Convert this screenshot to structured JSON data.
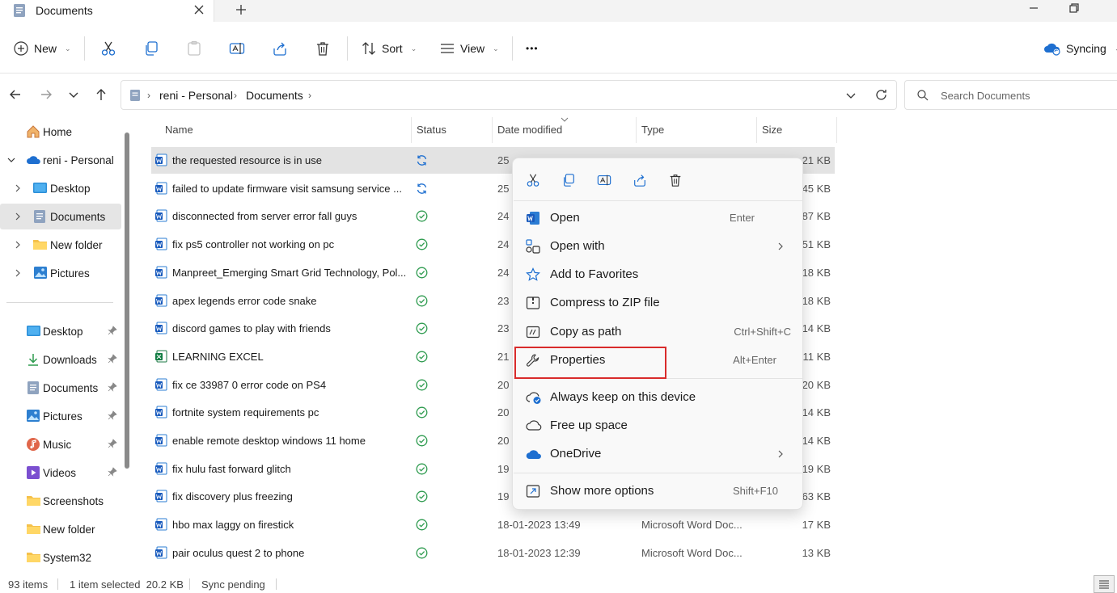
{
  "window": {
    "tab_title": "Documents",
    "sync_status": "Syncing"
  },
  "toolbar": {
    "new_label": "New",
    "sort_label": "Sort",
    "view_label": "View",
    "more_label": "•••"
  },
  "address": {
    "crumbs": [
      "reni - Personal",
      "Documents"
    ],
    "search_placeholder": "Search Documents"
  },
  "sidebar": {
    "tree": [
      {
        "label": "Home",
        "icon": "home-icon"
      },
      {
        "label": "reni - Personal",
        "icon": "onedrive-cloud-icon"
      },
      {
        "label": "Desktop",
        "icon": "desktop-folder-icon"
      },
      {
        "label": "Documents",
        "icon": "documents-folder-icon",
        "selected": true
      },
      {
        "label": "New folder",
        "icon": "folder-icon"
      },
      {
        "label": "Pictures",
        "icon": "pictures-folder-icon"
      }
    ],
    "quick_access": [
      {
        "label": "Desktop",
        "pinned": true
      },
      {
        "label": "Downloads",
        "pinned": true
      },
      {
        "label": "Documents",
        "pinned": true
      },
      {
        "label": "Pictures",
        "pinned": true
      },
      {
        "label": "Music",
        "pinned": true
      },
      {
        "label": "Videos",
        "pinned": true
      },
      {
        "label": "Screenshots",
        "pinned": false
      },
      {
        "label": "New folder",
        "pinned": false
      },
      {
        "label": "System32",
        "pinned": false
      }
    ]
  },
  "columns": {
    "name": "Name",
    "status": "Status",
    "date": "Date modified",
    "type": "Type",
    "size": "Size"
  },
  "files": [
    {
      "name": "the requested resource is in use",
      "status": "syncing",
      "date": "25",
      "type": "",
      "size": "21 KB",
      "icon": "word",
      "selected": true
    },
    {
      "name": "failed to update firmware visit samsung service ...",
      "status": "syncing",
      "date": "25",
      "type": "",
      "size": "45 KB",
      "icon": "word"
    },
    {
      "name": "disconnected from server error fall guys",
      "status": "synced",
      "date": "24",
      "type": "",
      "size": "87 KB",
      "icon": "word"
    },
    {
      "name": "fix ps5 controller not working on pc",
      "status": "synced",
      "date": "24",
      "type": "",
      "size": "51 KB",
      "icon": "word"
    },
    {
      "name": "Manpreet_Emerging Smart Grid Technology, Pol...",
      "status": "synced",
      "date": "24",
      "type": "",
      "size": "18 KB",
      "icon": "word"
    },
    {
      "name": "apex legends error code snake",
      "status": "synced",
      "date": "23",
      "type": "",
      "size": "18 KB",
      "icon": "word"
    },
    {
      "name": "discord games to play with friends",
      "status": "synced",
      "date": "23",
      "type": "",
      "size": "14 KB",
      "icon": "word"
    },
    {
      "name": "LEARNING EXCEL",
      "status": "synced",
      "date": "21",
      "type": "",
      "size": "11 KB",
      "icon": "excel"
    },
    {
      "name": "fix ce 33987 0 error code on PS4",
      "status": "synced",
      "date": "20",
      "type": "",
      "size": "20 KB",
      "icon": "word"
    },
    {
      "name": "fortnite system requirements pc",
      "status": "synced",
      "date": "20",
      "type": "",
      "size": "14 KB",
      "icon": "word"
    },
    {
      "name": "enable remote desktop windows 11 home",
      "status": "synced",
      "date": "20",
      "type": "",
      "size": "14 KB",
      "icon": "word"
    },
    {
      "name": "fix hulu fast forward glitch",
      "status": "synced",
      "date": "19",
      "type": "",
      "size": "19 KB",
      "icon": "word"
    },
    {
      "name": "fix discovery plus freezing",
      "status": "synced",
      "date": "19",
      "type": "",
      "size": "63 KB",
      "icon": "word"
    },
    {
      "name": "hbo max laggy on firestick",
      "status": "synced",
      "date": "18-01-2023 13:49",
      "type": "Microsoft Word Doc...",
      "size": "17 KB",
      "icon": "word"
    },
    {
      "name": "pair oculus quest 2 to phone",
      "status": "synced",
      "date": "18-01-2023 12:39",
      "type": "Microsoft Word Doc...",
      "size": "13 KB",
      "icon": "word"
    }
  ],
  "context_menu": {
    "items": [
      {
        "label": "Open",
        "shortcut": "Enter",
        "icon": "word-app-icon"
      },
      {
        "label": "Open with",
        "shortcut": "",
        "icon": "open-with-icon",
        "submenu": true
      },
      {
        "label": "Add to Favorites",
        "shortcut": "",
        "icon": "star-icon"
      },
      {
        "label": "Compress to ZIP file",
        "shortcut": "",
        "icon": "zip-icon"
      },
      {
        "label": "Copy as path",
        "shortcut": "Ctrl+Shift+C",
        "icon": "copy-path-icon"
      },
      {
        "label": "Properties",
        "shortcut": "Alt+Enter",
        "icon": "wrench-icon",
        "highlighted": true
      },
      {
        "label": "Always keep on this device",
        "shortcut": "",
        "icon": "cloud-sync-icon"
      },
      {
        "label": "Free up space",
        "shortcut": "",
        "icon": "cloud-outline-icon"
      },
      {
        "label": "OneDrive",
        "shortcut": "",
        "icon": "onedrive-icon",
        "submenu": true
      },
      {
        "label": "Show more options",
        "shortcut": "Shift+F10",
        "icon": "show-more-icon"
      }
    ]
  },
  "statusbar": {
    "item_count": "93 items",
    "selection": "1 item selected  20.2 KB",
    "sync": "Sync pending"
  },
  "colors": {
    "accent_blue": "#1e6fd0",
    "synced_green": "#2e9b4f",
    "highlight_red": "#d92b2b",
    "selection_gray": "#e3e3e3"
  }
}
